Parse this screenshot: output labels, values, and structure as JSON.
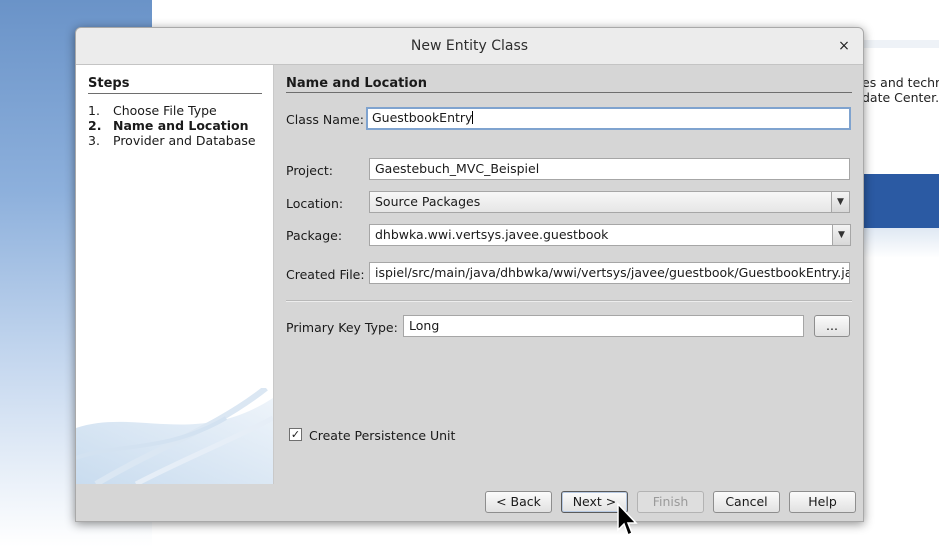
{
  "background": {
    "right_text_lines": [
      "es and techr",
      "date Center."
    ]
  },
  "dialog": {
    "title": "New Entity Class",
    "close_glyph": "×"
  },
  "steps": {
    "title": "Steps",
    "items": [
      {
        "num": "1.",
        "label": "Choose File Type",
        "active": false
      },
      {
        "num": "2.",
        "label": "Name and Location",
        "active": true
      },
      {
        "num": "3.",
        "label": "Provider and Database",
        "active": false
      }
    ]
  },
  "form": {
    "section_title": "Name and Location",
    "class_name": {
      "label": "Class Name:",
      "value": "GuestbookEntry"
    },
    "project": {
      "label": "Project:",
      "value": "Gaestebuch_MVC_Beispiel"
    },
    "location": {
      "label": "Location:",
      "value": "Source Packages"
    },
    "package": {
      "label": "Package:",
      "value": "dhbwka.wwi.vertsys.javee.guestbook"
    },
    "created_file": {
      "label": "Created File:",
      "value": "ispiel/src/main/java/dhbwka/wwi/vertsys/javee/guestbook/GuestbookEntry.java"
    },
    "primary_key_type": {
      "label": "Primary Key Type:",
      "value": "Long",
      "browse_label": "..."
    },
    "create_persistence_unit": {
      "label": "Create Persistence Unit",
      "checked": true,
      "check_glyph": "✓"
    }
  },
  "buttons": {
    "back": "< Back",
    "next": "Next >",
    "finish": "Finish",
    "cancel": "Cancel",
    "help": "Help"
  },
  "icons": {
    "close": "close-icon",
    "dropdown": "chevron-down-icon",
    "cursor": "mouse-pointer-icon"
  }
}
